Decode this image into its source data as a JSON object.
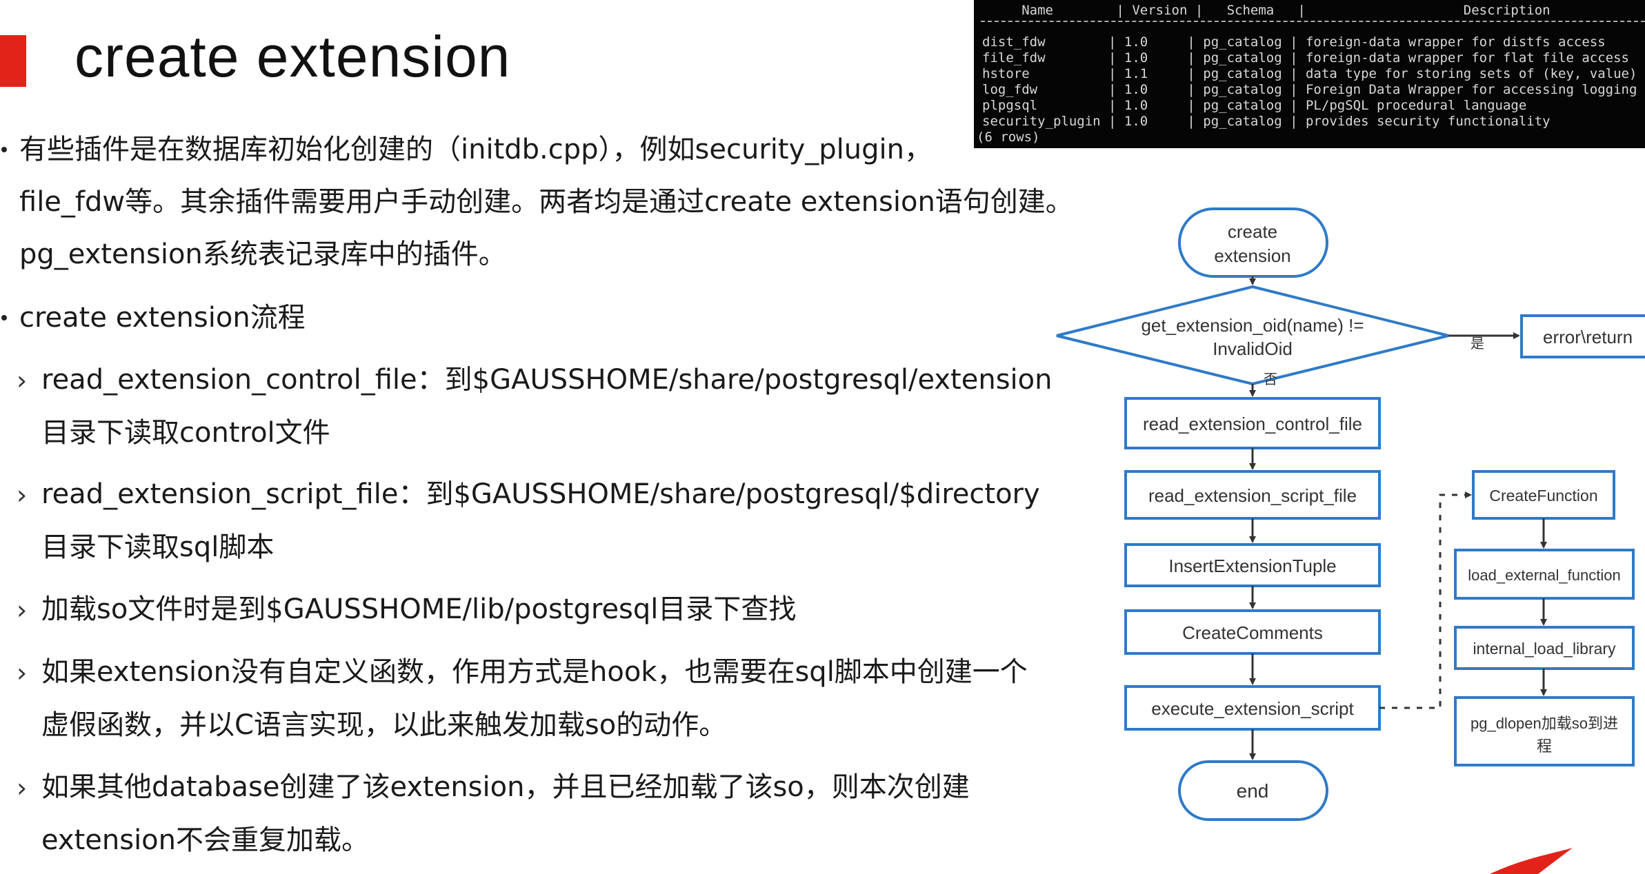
{
  "title": "create extension",
  "bullets": [
    {
      "lines": [
        "有些插件是在数据库初始化创建的（initdb.cpp），例如security_plugin，",
        "file_fdw等。其余插件需要用户手动创建。两者均是通过create extension语句创建。",
        "pg_extension系统表记录库中的插件。"
      ]
    },
    {
      "lines": [
        "create extension流程"
      ]
    }
  ],
  "subitems": [
    {
      "lines": [
        "read_extension_control_file：到$GAUSSHOME/share/postgresql/extension",
        "目录下读取control文件"
      ]
    },
    {
      "lines": [
        "read_extension_script_file：到$GAUSSHOME/share/postgresql/$directory",
        "目录下读取sql脚本"
      ]
    },
    {
      "lines": [
        "加载so文件时是到$GAUSSHOME/lib/postgresql目录下查找"
      ]
    },
    {
      "lines": [
        "如果extension没有自定义函数，作用方式是hook，也需要在sql脚本中创建一个",
        "虚假函数，并以C语言实现，以此来触发加载so的动作。"
      ]
    },
    {
      "lines": [
        "如果其他database创建了该extension，并且已经加载了该so，则本次创建",
        "extension不会重复加载。"
      ]
    }
  ],
  "terminal": {
    "header": "     Name        | Version |   Schema   |                    Description",
    "rows": [
      "dist_fdw        | 1.0     | pg_catalog | foreign-data wrapper for distfs access",
      "file_fdw        | 1.0     | pg_catalog | foreign-data wrapper for flat file access",
      "hstore          | 1.1     | pg_catalog | data type for storing sets of (key, value) pairs",
      "log_fdw         | 1.0     | pg_catalog | Foreign Data Wrapper for accessing logging data",
      "plpgsql         | 1.0     | pg_catalog | PL/pgSQL procedural language",
      "security_plugin | 1.0     | pg_catalog | provides security functionality"
    ],
    "footer": "(6 rows)"
  },
  "flow": {
    "start": [
      "create",
      "extension"
    ],
    "decision": [
      "get_extension_oid(name) !=",
      "InvalidOid"
    ],
    "yes_label": "是",
    "no_label": "否",
    "error": "error\\return",
    "steps": [
      "read_extension_control_file",
      "read_extension_script_file",
      "InsertExtensionTuple",
      "CreateComments",
      "execute_extension_script"
    ],
    "end": "end",
    "side": [
      "CreateFunction",
      "load_external_function",
      "internal_load_library"
    ],
    "side_last": [
      "pg_dlopen加载so到进",
      "程"
    ]
  },
  "colors": {
    "accent": "#e2231a",
    "flow_stroke": "#2f7ac8",
    "terminal_bg": "#050505"
  }
}
